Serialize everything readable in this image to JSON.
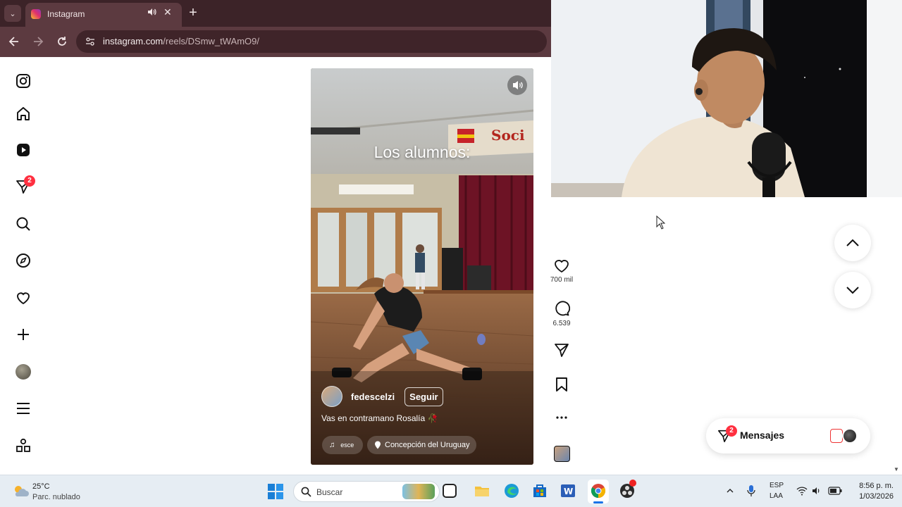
{
  "browser": {
    "tab_title": "Instagram",
    "url_host": "instagram.com",
    "url_path": "/reels/DSmw_tWAmO9/",
    "new_tab": "+",
    "tab_close": "✕",
    "tab_dropdown": "⌄"
  },
  "sidebar": {
    "items": [
      {
        "icon": "instagram-logo-icon"
      },
      {
        "icon": "home-icon"
      },
      {
        "icon": "reels-icon"
      },
      {
        "icon": "messages-icon",
        "badge": "2"
      },
      {
        "icon": "search-icon"
      },
      {
        "icon": "explore-icon"
      },
      {
        "icon": "notifications-heart-icon"
      },
      {
        "icon": "create-plus-icon"
      },
      {
        "icon": "profile-avatar"
      },
      {
        "icon": "more-menu-icon"
      },
      {
        "icon": "also-from-meta-icon"
      }
    ]
  },
  "reel": {
    "overlay_text": "Los alumnos:",
    "username": "fedescelzi",
    "follow_label": "Seguir",
    "caption": "Vas en contramano Rosalía 🥀",
    "audio_label": "esce",
    "location": "Concepción del Uruguay",
    "sign_text": "Soci"
  },
  "actions": {
    "likes": "700 mil",
    "comments": "6.539"
  },
  "messages": {
    "label": "Mensajes",
    "badge": "2"
  },
  "taskbar": {
    "weather_temp": "25°C",
    "weather_desc": "Parc. nublado",
    "search_placeholder": "Buscar",
    "lang_top": "ESP",
    "lang_bottom": "LAA",
    "time": "8:56 p. m.",
    "date": "1/03/2026"
  },
  "colors": {
    "brand_gradient": [
      "#f9c02e",
      "#e1306c",
      "#8a3ab9"
    ],
    "badge_red": "#ff3040",
    "chrome_frame": "#5c3a40"
  }
}
